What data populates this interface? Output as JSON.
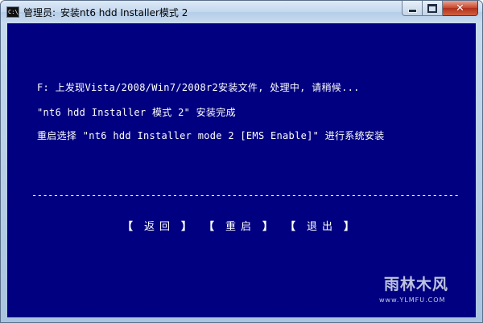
{
  "window": {
    "icon_text": "C:\\_",
    "title_prefix": "管理员:",
    "title": "安装nt6 hdd Installer模式 2",
    "controls": {
      "minimize": "minimize-icon",
      "maximize": "maximize-icon",
      "close": "close-icon",
      "close_glyph": "✕"
    }
  },
  "console": {
    "background": "#000080",
    "foreground": "#ffffff",
    "lines": [
      "F: 上发现Vista/2008/Win7/2008r2安装文件, 处理中, 请稍候...",
      "\"nt6 hdd Installer 模式 2\" 安装完成",
      "重启选择 \"nt6 hdd Installer mode 2 [EMS Enable]\" 进行系统安装"
    ],
    "divider": "------------------------------------------------------------------------------------------------------------------",
    "menu": {
      "open_bracket": "【",
      "close_bracket": "】",
      "back": "返回",
      "reboot": "重启",
      "exit": "退出"
    }
  },
  "watermark": {
    "logo": "雨林木风",
    "url": "www.YLMFU.COM"
  }
}
